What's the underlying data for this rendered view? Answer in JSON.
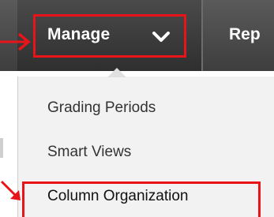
{
  "nav": {
    "manage_label": "Manage",
    "next_tab_label": "Rep"
  },
  "menu": {
    "items": [
      {
        "label": "Grading Periods"
      },
      {
        "label": "Smart Views"
      },
      {
        "label": "Column Organization"
      }
    ]
  },
  "annotations": {
    "highlight_color": "#e8141a"
  },
  "icons": {
    "menu_toggle": "chevron-down-icon",
    "callout": "arrow-right-icon"
  }
}
